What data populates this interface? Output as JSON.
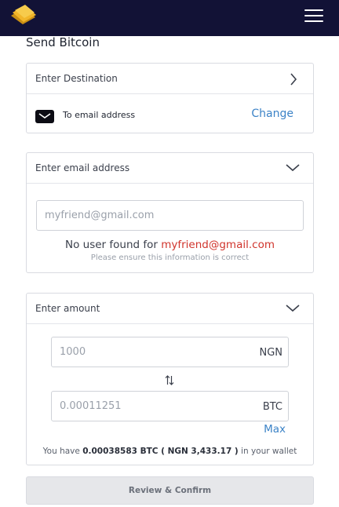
{
  "header": {
    "logo_icon": "wallet-cards-logo",
    "menu_icon": "hamburger-menu-icon",
    "bg_color": "#121236"
  },
  "page": {
    "title": "Send Bitcoin"
  },
  "destination": {
    "label": "Enter Destination",
    "selected": "To email address",
    "change_label": "Change"
  },
  "email_section": {
    "label": "Enter email address",
    "input_placeholder": "myfriend@gmail.com",
    "no_user_prefix": "No user found for ",
    "no_user_email": "myfriend@gmail.com",
    "hint": "Please ensure this information is correct"
  },
  "amount_section": {
    "label": "Enter amount",
    "ngn_placeholder": "1000",
    "ngn_suffix": "NGN",
    "btc_placeholder": "0.00011251",
    "btc_suffix": "BTC",
    "max_label": "Max",
    "wallet_prefix": "You have ",
    "wallet_amount": "0.00038583 BTC ( NGN 3,433.17 )",
    "wallet_suffix": " in your wallet"
  },
  "actions": {
    "review_label": "Review & Confirm"
  },
  "colors": {
    "link": "#3c83c7",
    "error": "#d0342c"
  }
}
